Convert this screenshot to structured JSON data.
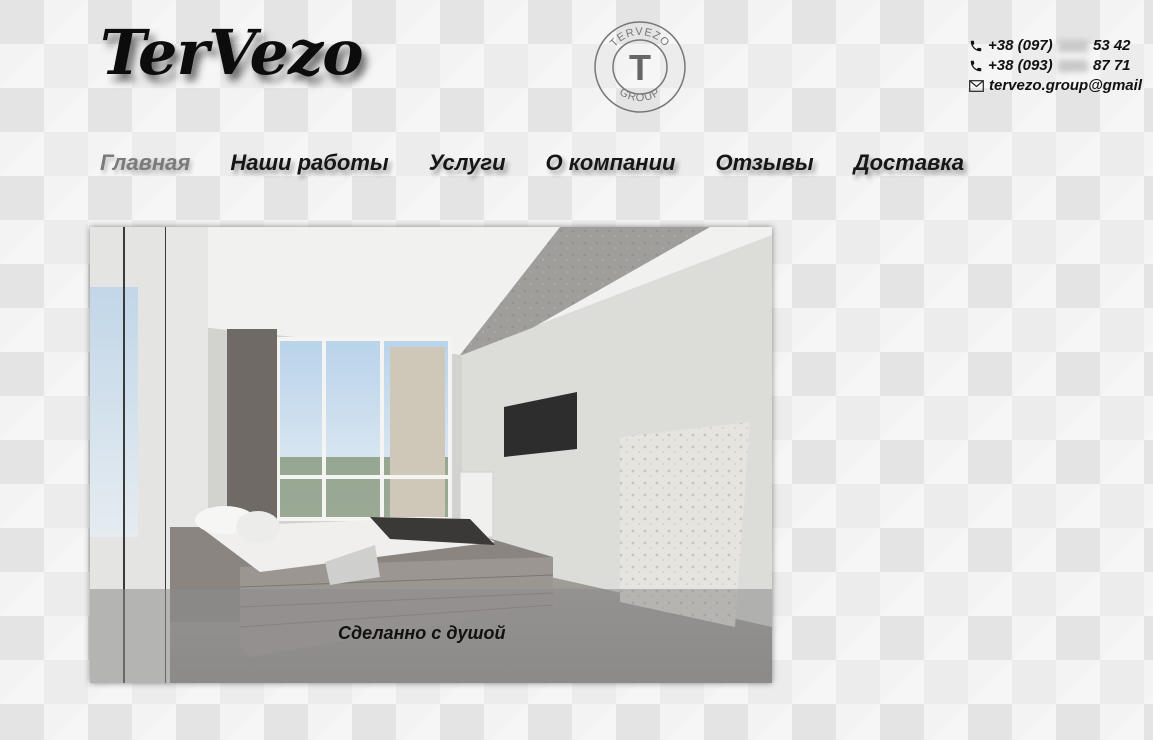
{
  "header": {
    "logo_text": "TerVezo",
    "emblem": {
      "top_text": "TERVEZO",
      "letter": "T",
      "bottom_text": "GROUP"
    }
  },
  "contacts": {
    "phone1_prefix": "+38 (097)",
    "phone1_suffix": "53 42",
    "phone2_prefix": "+38 (093)",
    "phone2_suffix": "87 71",
    "email": "tervezo.group@gmail",
    "phone_icon": "phone-icon",
    "mail_icon": "envelope-icon"
  },
  "nav": {
    "items": [
      {
        "label": "Главная",
        "active": true
      },
      {
        "label": "Наши работы"
      },
      {
        "label": "Услуги"
      },
      {
        "label": "О компании"
      },
      {
        "label": "Отзывы"
      },
      {
        "label": "Доставка"
      }
    ]
  },
  "hero": {
    "caption": "Сделанно с душой"
  }
}
